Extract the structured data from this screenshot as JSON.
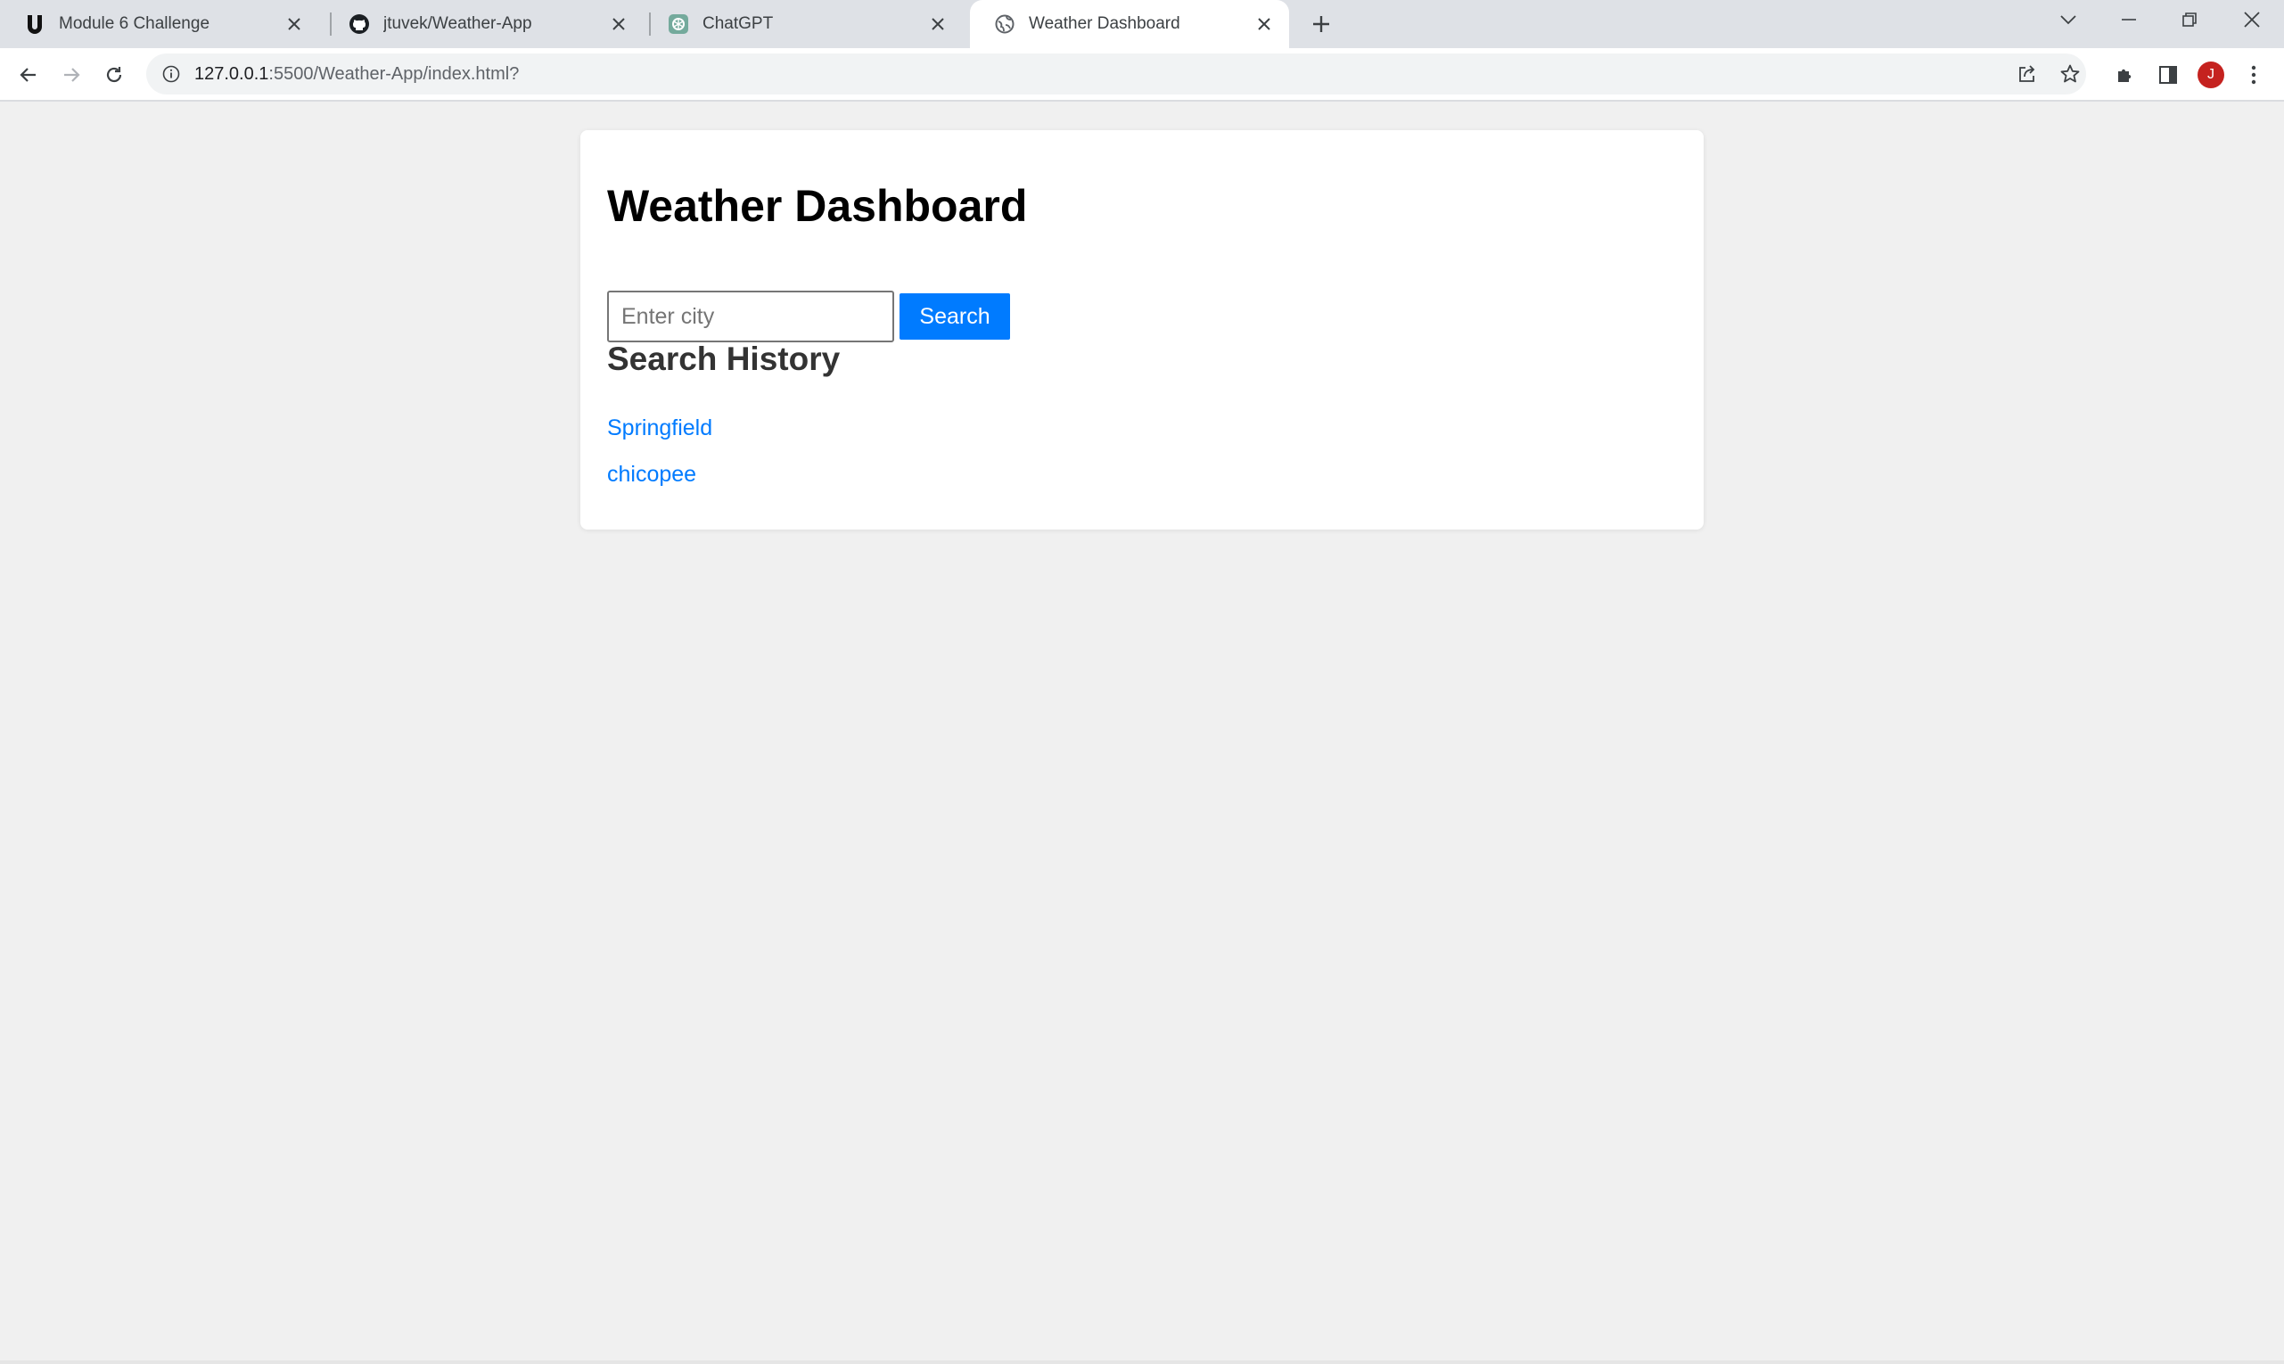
{
  "browser": {
    "tabs": [
      {
        "title": "Module 6 Challenge",
        "favicon": "u-logo-icon",
        "active": false
      },
      {
        "title": "jtuvek/Weather-App",
        "favicon": "github-icon",
        "active": false
      },
      {
        "title": "ChatGPT",
        "favicon": "chatgpt-icon",
        "active": false
      },
      {
        "title": "Weather Dashboard",
        "favicon": "globe-icon",
        "active": true
      }
    ],
    "url_host": "127.0.0.1",
    "url_path": ":5500/Weather-App/index.html?",
    "profile_initial": "J"
  },
  "page": {
    "title": "Weather Dashboard",
    "search": {
      "placeholder": "Enter city",
      "value": "",
      "button_label": "Search"
    },
    "history": {
      "heading": "Search History",
      "items": [
        "Springfield",
        "chicopee"
      ]
    }
  },
  "colors": {
    "accent": "#007bff",
    "page_bg": "#f0f0f0",
    "card_bg": "#ffffff",
    "tabstrip_bg": "#dee1e6",
    "profile_bg": "#c5221f"
  }
}
